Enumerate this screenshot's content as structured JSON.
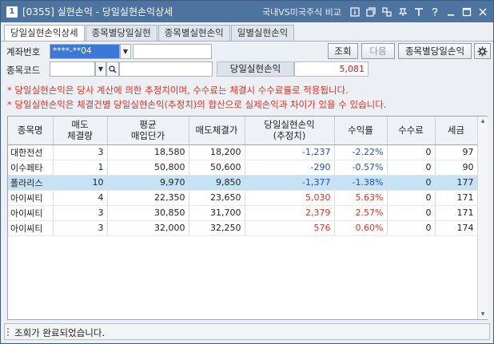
{
  "window": {
    "title": "[0355] 실현손익 - 당일실현손익상세",
    "compare_link": "국내VS미국주식 비교",
    "icon_glyph": "1"
  },
  "tabs": [
    {
      "label": "당일실현손익상세",
      "active": true
    },
    {
      "label": "종목별당일실현"
    },
    {
      "label": "종목별실현손익"
    },
    {
      "label": "일별실현손익"
    }
  ],
  "form": {
    "account_label": "계좌번호",
    "account_value": "****-**04",
    "code_label": "종목코드",
    "code_value": "",
    "pl_label": "당일실현손익",
    "pl_value": "5,081",
    "query_button": "조회",
    "next_button": "다음",
    "by_stock_button": "종목별당일손익"
  },
  "notices": [
    "* 당일실현손익은 당사 계산에 의한 추정치이며, 수수료는 체결시 수수료률로 적용됩니다.",
    "* 당일실현손익은 체결건별 당일실현손익(추정치)의 합산으로 실제손익과 차이가 있을 수 있습니다."
  ],
  "table": {
    "headers": [
      [
        "종목명"
      ],
      [
        "매도",
        "체결량"
      ],
      [
        "평균",
        "매입단가"
      ],
      [
        "매도체결가"
      ],
      [
        "당일실현손익",
        "(추정치)"
      ],
      [
        "수익률"
      ],
      [
        "수수료"
      ],
      [
        "세금"
      ]
    ],
    "rows": [
      {
        "name": "대한전선",
        "qty": "3",
        "avg": "18,580",
        "sell": "18,200",
        "pl": "-1,237",
        "rate": "-2.22%",
        "fee": "0",
        "tax": "97",
        "sign": "neg"
      },
      {
        "name": "이수페타",
        "qty": "1",
        "avg": "50,800",
        "sell": "50,600",
        "pl": "-290",
        "rate": "-0.57%",
        "fee": "0",
        "tax": "90",
        "sign": "neg"
      },
      {
        "name": "폴라리스",
        "qty": "10",
        "avg": "9,970",
        "sell": "9,850",
        "pl": "-1,377",
        "rate": "-1.38%",
        "fee": "0",
        "tax": "177",
        "sign": "neg",
        "selected": true
      },
      {
        "name": "아이씨티",
        "qty": "4",
        "avg": "22,350",
        "sell": "23,650",
        "pl": "5,030",
        "rate": "5.63%",
        "fee": "0",
        "tax": "171",
        "sign": "pos"
      },
      {
        "name": "아이씨티",
        "qty": "3",
        "avg": "30,850",
        "sell": "31,700",
        "pl": "2,379",
        "rate": "2.57%",
        "fee": "0",
        "tax": "171",
        "sign": "pos"
      },
      {
        "name": "아이씨티",
        "qty": "3",
        "avg": "32,000",
        "sell": "32,250",
        "pl": "576",
        "rate": "0.60%",
        "fee": "0",
        "tax": "174",
        "sign": "pos"
      }
    ]
  },
  "status": {
    "message": "조회가 완료되었습니다."
  },
  "colors": {
    "titlebar": "#4d73a0",
    "negative": "#1f4fc4",
    "positive": "#e0311f",
    "selected_row": "#c6e3f5"
  }
}
